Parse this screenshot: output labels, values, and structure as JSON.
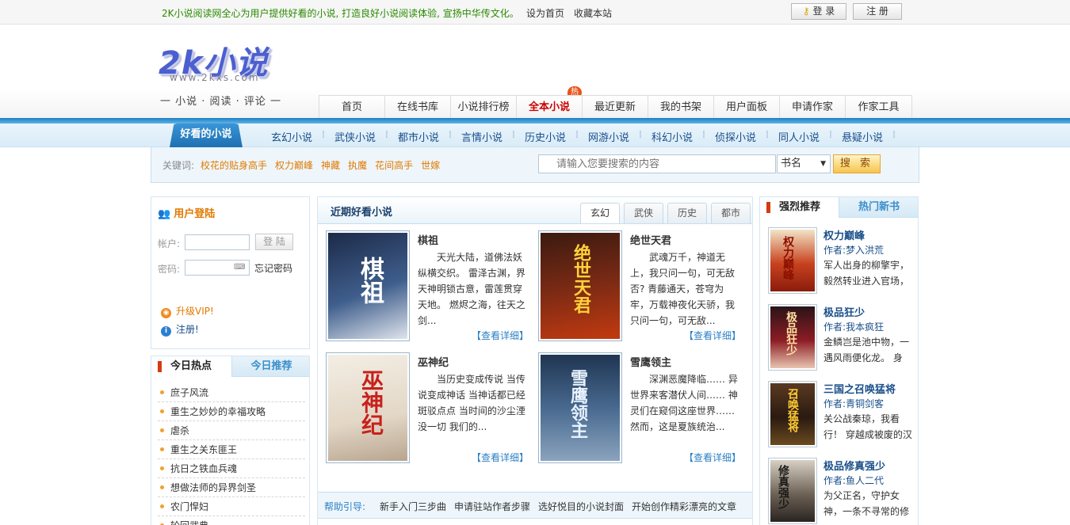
{
  "topbar": {
    "slogan": "2K小说阅读网全心为用户提供好看的小说, 打造良好小说阅读体验, 宣扬中华传文化。",
    "set_home": "设为首页",
    "bookmark": "收藏本站",
    "login": "登 录",
    "register": "注 册"
  },
  "header": {
    "logo": "2k小说",
    "logo_url": "www.2kxs.com",
    "tagline": "一  小说 · 阅读 · 评论  一",
    "hot_badge": "热",
    "nav": [
      "首页",
      "在线书库",
      "小说排行榜",
      "全本小说",
      "最近更新",
      "我的书架",
      "用户面板",
      "申请作家",
      "作家工具"
    ]
  },
  "subnav": {
    "title": "好看的小说",
    "items": [
      "玄幻小说",
      "武侠小说",
      "都市小说",
      "言情小说",
      "历史小说",
      "网游小说",
      "科幻小说",
      "侦探小说",
      "同人小说",
      "悬疑小说"
    ]
  },
  "search": {
    "keyword_label": "关键词:",
    "keywords": [
      "校花的贴身高手",
      "权力巅峰",
      "神藏",
      "执魔",
      "花间高手",
      "世嫁"
    ],
    "placeholder": "请输入您要搜索的内容",
    "select_value": "书名",
    "button": "搜 索"
  },
  "login": {
    "title": "用户登陆",
    "account_label": "帐户:",
    "password_label": "密码:",
    "login_button": "登 陆",
    "forgot": "忘记密码",
    "vip": "升级VIP!",
    "register": "注册!"
  },
  "hot": {
    "tab_today_hot": "今日热点",
    "tab_today_rec": "今日推荐",
    "items": [
      "庶子风流",
      "重生之妙妙的幸福攻略",
      "虐杀",
      "重生之关东匪王",
      "抗日之铁血兵魂",
      "想做法师的异界剑圣",
      "农门悍妇",
      "轮回武典"
    ]
  },
  "center": {
    "title": "近期好看小说",
    "tabs": [
      "玄幻",
      "武侠",
      "历史",
      "都市"
    ],
    "more": "【查看详细】",
    "books": [
      {
        "title": "棋祖",
        "desc": "天光大陆，道佛法妖纵横交织。 雷泽古渊，界天神明锁古意，雷莲贯穿天地。 燃烬之海，往天之剑...",
        "cover_text": "棋祖",
        "cover_bg": "#2b3f63"
      },
      {
        "title": "绝世天君",
        "desc": "武魂万千，神道无上，我只问一句，可无敌否? 青藤通天，苍穹为牢，万载神夜化天骄，我只问一句，可无敌...",
        "cover_text": "绝世天君",
        "cover_bg": "#5a2418"
      },
      {
        "title": "巫神纪",
        "desc": "当历史变成传说 当传说变成神话 当神话都已经斑驳点点 当时间的沙尘湮没一切 我们的...",
        "cover_text": "巫神纪",
        "cover_bg": "#e9e3d6"
      },
      {
        "title": "雪鹰领主",
        "desc": "深渊恶魔降临…… 异世界来客潜伏人间…… 神灵们在窥伺这座世界…… 然而，这是夏族统治...",
        "cover_text": "雪鹰领主",
        "cover_bg": "#2e4a6b"
      }
    ],
    "help_label": "帮助引导:",
    "help_items": [
      "新手入门三步曲",
      "申请驻站作者步骤",
      "选好悦目的小说封面",
      "开始创作精彩漂亮的文章"
    ]
  },
  "right": {
    "tab_strong": "强烈推荐",
    "tab_new": "热门新书",
    "author_label": "作者:",
    "items": [
      {
        "title": "权力巅峰",
        "author": "梦入洪荒",
        "desc": "军人出身的柳擎宇，毅然转业进入官场，",
        "cover_text": "权力巅峰",
        "cover_bg": "#b83a1e"
      },
      {
        "title": "极品狂少",
        "author": "我本疯狂",
        "desc": "金鳞岂是池中物，一遇风雨便化龙。 身",
        "cover_text": "极品狂少",
        "cover_bg": "#7a1420"
      },
      {
        "title": "三国之召唤猛将",
        "author": "青铜剑客",
        "desc": "关公战秦琼，我看行！ 穿越成被废的汉",
        "cover_text": "召唤猛将",
        "cover_bg": "#3a2a1a"
      },
      {
        "title": "极品修真强少",
        "author": "鱼人二代",
        "desc": "为父正名，守护女神，一条不寻常的修仙",
        "cover_text": "修真强少",
        "cover_bg": "#6d6256"
      }
    ]
  },
  "colors": {
    "accent_blue": "#1d7fc6",
    "accent_orange": "#e07a00",
    "slogan_green": "#2a8a00"
  }
}
